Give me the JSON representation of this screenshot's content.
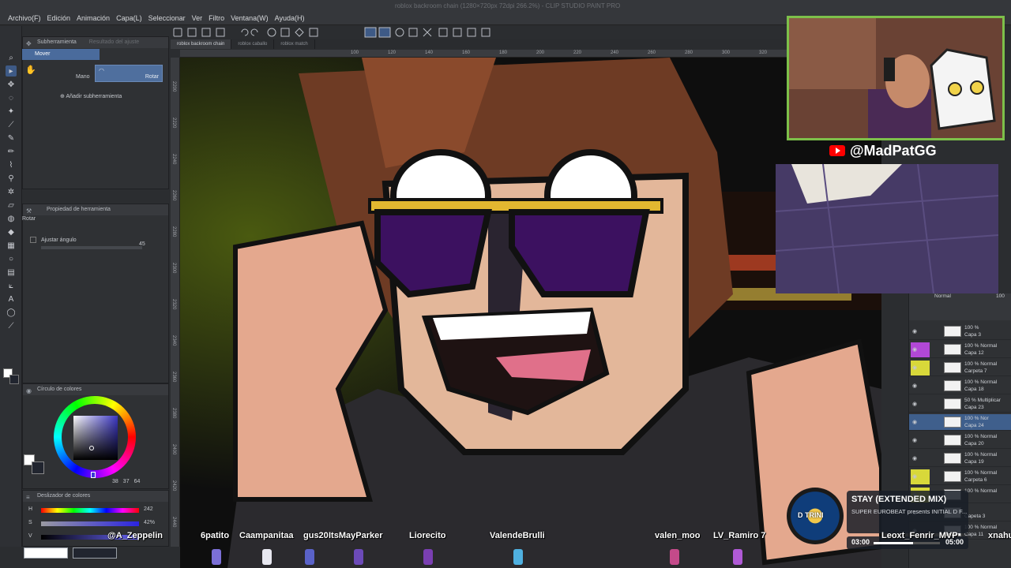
{
  "app": {
    "doc_title": "roblox backroom chain (1280×720px 72dpi 266.2%) - CLIP STUDIO PAINT PRO"
  },
  "menu": [
    "Archivo(F)",
    "Edición",
    "Animación",
    "Capa(L)",
    "Seleccionar",
    "Ver",
    "Filtro",
    "Ventana(W)",
    "Ayuda(H)"
  ],
  "subtool_panel": {
    "tab1": "Subherramienta",
    "tab2": "Resultado del ajuste",
    "selected_item": "Mover",
    "mano_label": "Mano",
    "rotar_label": "Rotar",
    "add_subtool": "Añadir subherramienta"
  },
  "tool_property": {
    "title": "Propiedad de herramienta",
    "section": "Rotar",
    "adjust_angle_label": "Ajustar ángulo",
    "angle_value": "45"
  },
  "color_circle": {
    "title": "Círculo de colores",
    "r": "38",
    "g": "37",
    "b": "64"
  },
  "color_slider": {
    "title": "Deslizador de colores",
    "h_label": "H",
    "s_label": "S",
    "v_label": "V",
    "h_value": "242",
    "s_value": "42%"
  },
  "canvas_tabs": [
    "roblox backroom chain",
    "roblox caballo",
    "roblox match"
  ],
  "ruler_top_ticks": [
    "100",
    "120",
    "140",
    "160",
    "180",
    "200",
    "220",
    "240",
    "260",
    "280",
    "300",
    "320",
    "340",
    "360",
    "380",
    "400"
  ],
  "ruler_left_ticks": [
    "2200",
    "2220",
    "2240",
    "2260",
    "2280",
    "2300",
    "2320",
    "2340",
    "2360",
    "2380",
    "2400",
    "2420",
    "2440"
  ],
  "webcam": {
    "channel": "@MadPatGG"
  },
  "layers": [
    {
      "line1": "100 %",
      "line2": "Capa 3",
      "color": ""
    },
    {
      "line1": "100 % Normal",
      "line2": "Capa 12",
      "color": "#b148d6"
    },
    {
      "line1": "100 % Normal",
      "line2": "Carpeta 7",
      "color": "#d8d83a"
    },
    {
      "line1": "100 % Normal",
      "line2": "Capa 18",
      "color": ""
    },
    {
      "line1": "50 % Multiplicar",
      "line2": "Capa 23",
      "color": ""
    },
    {
      "line1": "100 % Nor",
      "line2": "Capa 24",
      "color": "",
      "selected": true
    },
    {
      "line1": "100 % Normal",
      "line2": "Capa 20",
      "color": ""
    },
    {
      "line1": "100 % Normal",
      "line2": "Capa 19",
      "color": ""
    },
    {
      "line1": "100 % Normal",
      "line2": "Carpeta 6",
      "color": "#d8d83a"
    },
    {
      "line1": "100 % Normal",
      "line2": "",
      "color": "#d8d83a"
    },
    {
      "line1": "",
      "line2": "Capeta 3",
      "color": ""
    },
    {
      "line1": "100 % Normal",
      "line2": "Capa 11",
      "color": ""
    }
  ],
  "layers_header": {
    "blend": "Normal",
    "opacity": "100"
  },
  "music": {
    "title": "STAY (EXTENDED MIX)",
    "artist": "SUPER EUROBEAT presents INITIAL D F...",
    "time_start": "03:00",
    "time_end": "05:00",
    "progress": 0.6,
    "disc_text": "D TRINI"
  },
  "chatters": [
    {
      "name": "@A_Zeppelin"
    },
    {
      "name": "6patito"
    },
    {
      "name": "Caampanitaa"
    },
    {
      "name": "gus20"
    },
    {
      "name": "ItsMayParker"
    },
    {
      "name": "Liorecito"
    },
    {
      "name": "ValendeBrulli"
    },
    {
      "name": "valen_moo"
    },
    {
      "name": "LV_Ramiro 7"
    },
    {
      "name": "Leoxt_Fenrir_MVP"
    },
    {
      "name": "xnahu"
    }
  ],
  "colors": {
    "accent": "#4a6b9c",
    "webcam_border": "#7dc04a",
    "youtube": "#ff0000"
  }
}
